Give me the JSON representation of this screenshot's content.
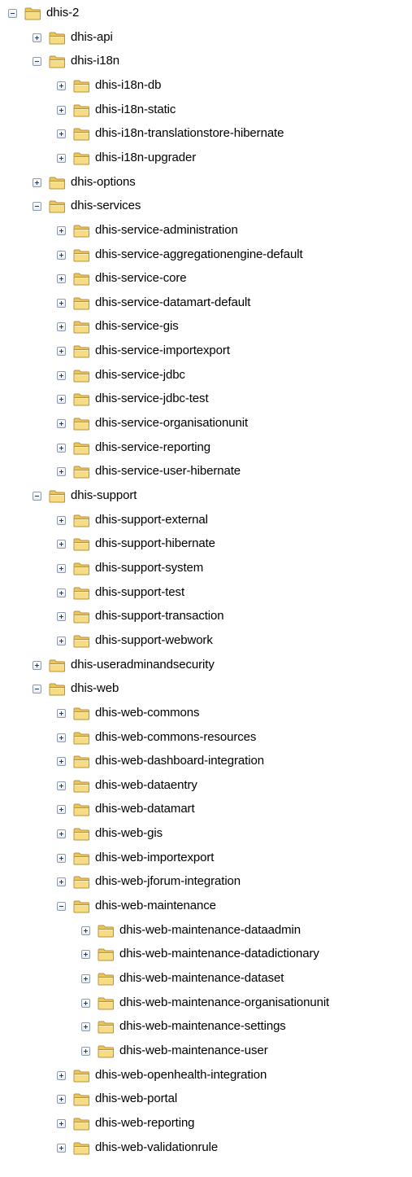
{
  "tree": {
    "nodes": [
      {
        "label": "dhis-2",
        "expanded": true,
        "depth": 0
      },
      {
        "label": "dhis-api",
        "expanded": false,
        "depth": 1
      },
      {
        "label": "dhis-i18n",
        "expanded": true,
        "depth": 1
      },
      {
        "label": "dhis-i18n-db",
        "expanded": false,
        "depth": 2
      },
      {
        "label": "dhis-i18n-static",
        "expanded": false,
        "depth": 2
      },
      {
        "label": "dhis-i18n-translationstore-hibernate",
        "expanded": false,
        "depth": 2
      },
      {
        "label": "dhis-i18n-upgrader",
        "expanded": false,
        "depth": 2
      },
      {
        "label": "dhis-options",
        "expanded": false,
        "depth": 1
      },
      {
        "label": "dhis-services",
        "expanded": true,
        "depth": 1
      },
      {
        "label": "dhis-service-administration",
        "expanded": false,
        "depth": 2
      },
      {
        "label": "dhis-service-aggregationengine-default",
        "expanded": false,
        "depth": 2
      },
      {
        "label": "dhis-service-core",
        "expanded": false,
        "depth": 2
      },
      {
        "label": "dhis-service-datamart-default",
        "expanded": false,
        "depth": 2
      },
      {
        "label": "dhis-service-gis",
        "expanded": false,
        "depth": 2
      },
      {
        "label": "dhis-service-importexport",
        "expanded": false,
        "depth": 2
      },
      {
        "label": "dhis-service-jdbc",
        "expanded": false,
        "depth": 2
      },
      {
        "label": "dhis-service-jdbc-test",
        "expanded": false,
        "depth": 2
      },
      {
        "label": "dhis-service-organisationunit",
        "expanded": false,
        "depth": 2
      },
      {
        "label": "dhis-service-reporting",
        "expanded": false,
        "depth": 2
      },
      {
        "label": "dhis-service-user-hibernate",
        "expanded": false,
        "depth": 2
      },
      {
        "label": "dhis-support",
        "expanded": true,
        "depth": 1
      },
      {
        "label": "dhis-support-external",
        "expanded": false,
        "depth": 2
      },
      {
        "label": "dhis-support-hibernate",
        "expanded": false,
        "depth": 2
      },
      {
        "label": "dhis-support-system",
        "expanded": false,
        "depth": 2
      },
      {
        "label": "dhis-support-test",
        "expanded": false,
        "depth": 2
      },
      {
        "label": "dhis-support-transaction",
        "expanded": false,
        "depth": 2
      },
      {
        "label": "dhis-support-webwork",
        "expanded": false,
        "depth": 2
      },
      {
        "label": "dhis-useradminandsecurity",
        "expanded": false,
        "depth": 1
      },
      {
        "label": "dhis-web",
        "expanded": true,
        "depth": 1
      },
      {
        "label": "dhis-web-commons",
        "expanded": false,
        "depth": 2
      },
      {
        "label": "dhis-web-commons-resources",
        "expanded": false,
        "depth": 2
      },
      {
        "label": "dhis-web-dashboard-integration",
        "expanded": false,
        "depth": 2
      },
      {
        "label": "dhis-web-dataentry",
        "expanded": false,
        "depth": 2
      },
      {
        "label": "dhis-web-datamart",
        "expanded": false,
        "depth": 2
      },
      {
        "label": "dhis-web-gis",
        "expanded": false,
        "depth": 2
      },
      {
        "label": "dhis-web-importexport",
        "expanded": false,
        "depth": 2
      },
      {
        "label": "dhis-web-jforum-integration",
        "expanded": false,
        "depth": 2
      },
      {
        "label": "dhis-web-maintenance",
        "expanded": true,
        "depth": 2
      },
      {
        "label": "dhis-web-maintenance-dataadmin",
        "expanded": false,
        "depth": 3
      },
      {
        "label": "dhis-web-maintenance-datadictionary",
        "expanded": false,
        "depth": 3
      },
      {
        "label": "dhis-web-maintenance-dataset",
        "expanded": false,
        "depth": 3
      },
      {
        "label": "dhis-web-maintenance-organisationunit",
        "expanded": false,
        "depth": 3
      },
      {
        "label": "dhis-web-maintenance-settings",
        "expanded": false,
        "depth": 3
      },
      {
        "label": "dhis-web-maintenance-user",
        "expanded": false,
        "depth": 3
      },
      {
        "label": "dhis-web-openhealth-integration",
        "expanded": false,
        "depth": 2
      },
      {
        "label": "dhis-web-portal",
        "expanded": false,
        "depth": 2
      },
      {
        "label": "dhis-web-reporting",
        "expanded": false,
        "depth": 2
      },
      {
        "label": "dhis-web-validationrule",
        "expanded": false,
        "depth": 2
      }
    ]
  },
  "colors": {
    "folder_fill": "#f7dc86",
    "folder_tab": "#edc55b",
    "folder_stroke": "#b8913a",
    "toggle_border": "#8c9aab",
    "toggle_glyph": "#1d3a6e"
  }
}
